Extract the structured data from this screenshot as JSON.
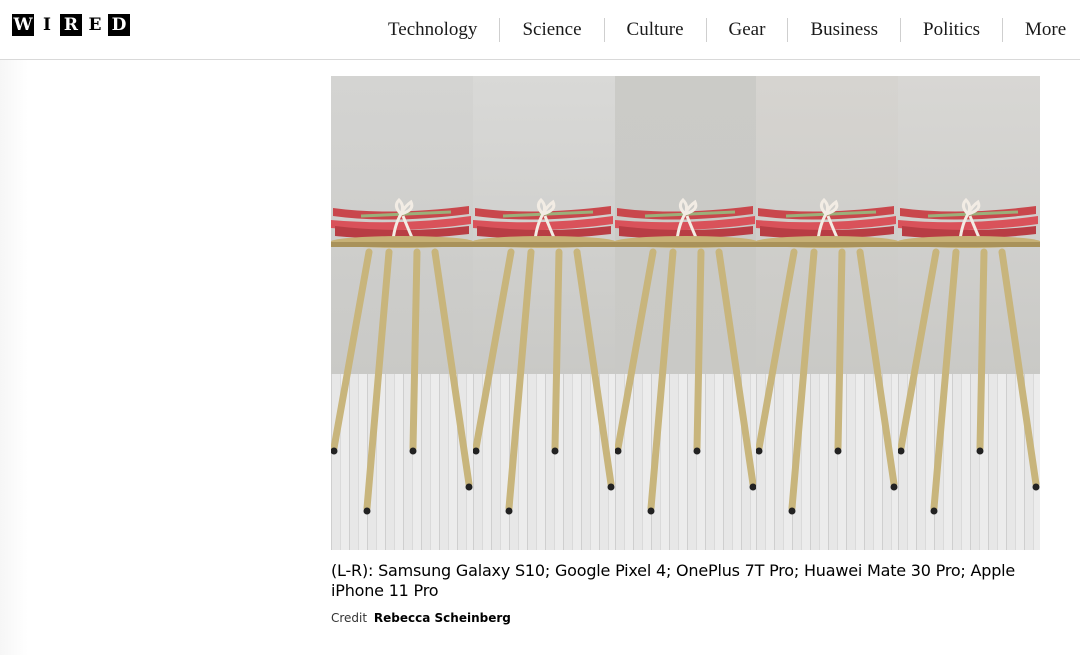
{
  "logo": {
    "letters": [
      "W",
      "I",
      "R",
      "E",
      "D"
    ]
  },
  "nav": {
    "items": [
      "Technology",
      "Science",
      "Culture",
      "Gear",
      "Business",
      "Politics",
      "More"
    ]
  },
  "figure": {
    "panels": [
      {
        "wall": "#d4d4d2"
      },
      {
        "wall": "#d9d9d7"
      },
      {
        "wall": "#cbcbc7"
      },
      {
        "wall": "#d6d4d0"
      },
      {
        "wall": "#d8d7d4"
      }
    ],
    "caption": "(L-R): Samsung Galaxy S10; Google Pixel 4; OnePlus 7T Pro; Huawei Mate 30 Pro; Apple iPhone 11 Pro",
    "credit_label": "Credit",
    "credit_name": "Rebecca Scheinberg"
  }
}
